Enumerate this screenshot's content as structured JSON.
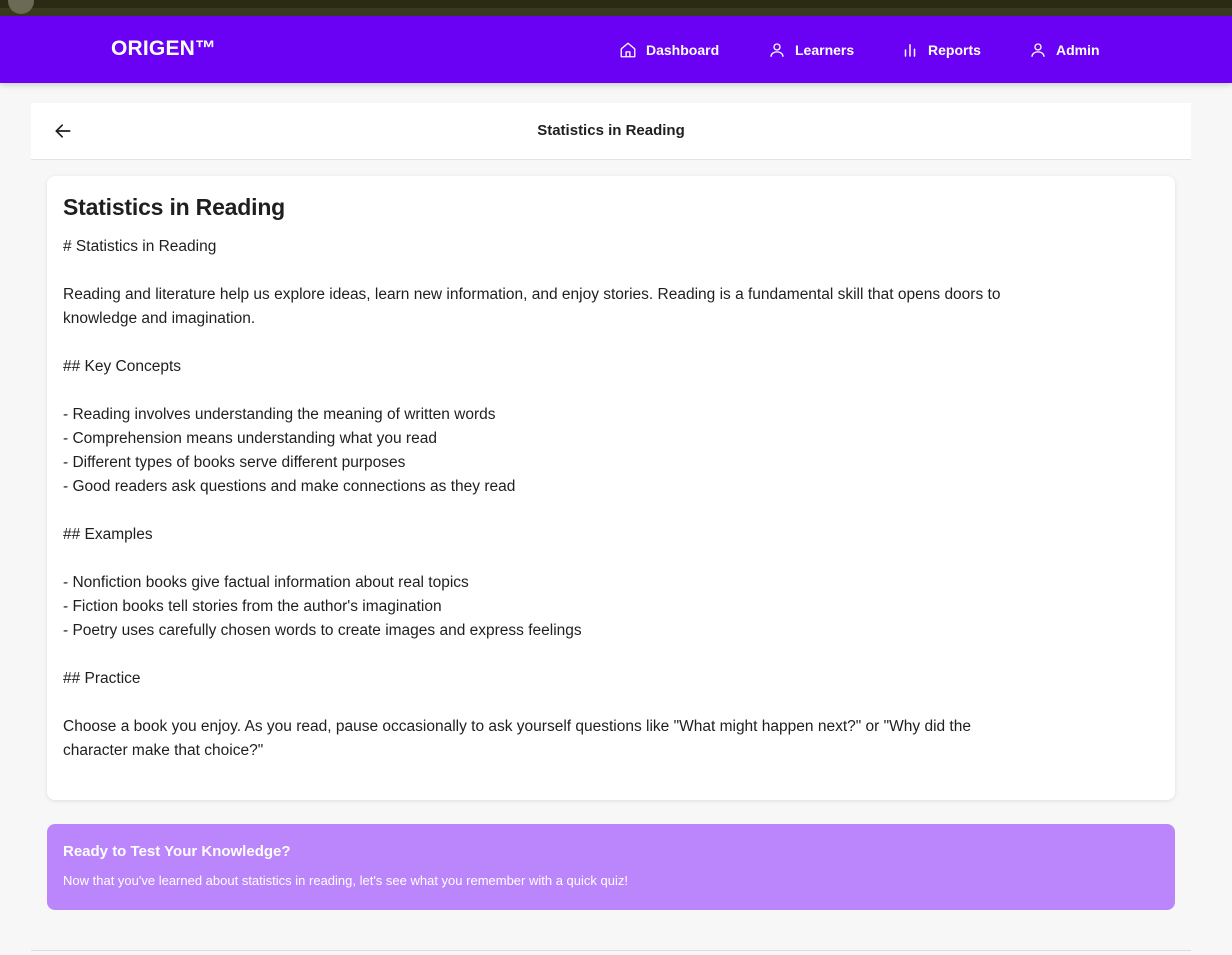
{
  "app": {
    "brand": "ORIGEN™"
  },
  "nav": {
    "dashboard": "Dashboard",
    "learners": "Learners",
    "reports": "Reports",
    "admin": "Admin"
  },
  "header": {
    "title": "Statistics in Reading"
  },
  "content": {
    "title": "Statistics in Reading",
    "lines": [
      "# Statistics in Reading",
      "",
      "Reading and literature help us explore ideas, learn new information, and enjoy stories. Reading is a fundamental skill that opens doors to",
      "knowledge and imagination.",
      "",
      "## Key Concepts",
      "",
      "- Reading involves understanding the meaning of written words",
      "- Comprehension means understanding what you read",
      "- Different types of books serve different purposes",
      "- Good readers ask questions and make connections as they read",
      "",
      "## Examples",
      "",
      "- Nonfiction books give factual information about real topics",
      "- Fiction books tell stories from the author's imagination",
      "- Poetry uses carefully chosen words to create images and express feelings",
      "",
      "## Practice",
      "",
      "Choose a book you enjoy. As you read, pause occasionally to ask yourself questions like \"What might happen next?\" or \"Why did the",
      "character make that choice?\""
    ]
  },
  "quiz": {
    "title": "Ready to Test Your Knowledge?",
    "text": "Now that you've learned about statistics in reading, let's see what you remember with a quick quiz!"
  },
  "colors": {
    "navbar": "#6a00f4",
    "quiz_banner": "#bb85fb"
  },
  "icons": {
    "dashboard": "home-icon",
    "learners": "user-icon",
    "reports": "bar-chart-icon",
    "admin": "user-icon",
    "back": "arrow-left-icon"
  }
}
